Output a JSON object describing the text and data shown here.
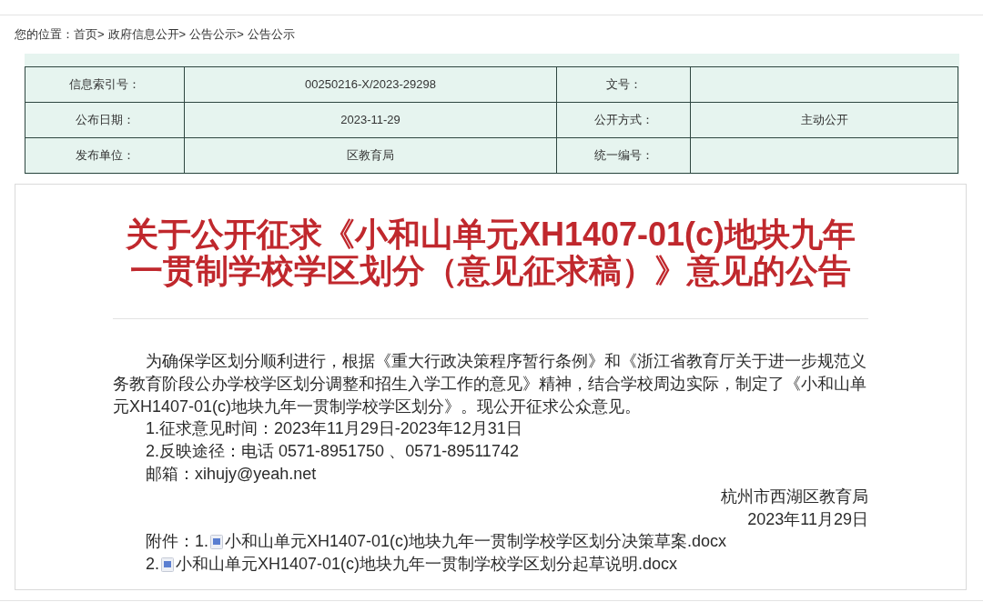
{
  "breadcrumb": {
    "label": "您的位置：",
    "separator": ">",
    "items": [
      "首页",
      "政府信息公开",
      "公告公示",
      "公告公示"
    ]
  },
  "info_table": {
    "rows": [
      {
        "cells": [
          {
            "label": "信息索引号：",
            "value": "00250216-X/2023-29298"
          },
          {
            "label": "文号："
          }
        ]
      },
      {
        "cells": [
          {
            "label": "公布日期：",
            "value": "2023-11-29"
          },
          {
            "label": "公开方式：",
            "value": "主动公开"
          }
        ]
      },
      {
        "cells": [
          {
            "label": "发布单位：",
            "value": "区教育局"
          },
          {
            "label": "统一编号："
          }
        ]
      }
    ]
  },
  "article": {
    "title": "关于公开征求《小和山单元XH1407-01(c)地块九年一贯制学校学区划分（意见征求稿）》意见的公告",
    "body": "为确保学区划分顺利进行，根据《重大行政决策程序暂行条例》和《浙江省教育厅关于进一步规范义务教育阶段公办学校学区划分调整和招生入学工作的意见》精神，结合学校周边实际，制定了《小和山单元XH1407-01(c)地块九年一贯制学校学区划分》。现公开征求公众意见。",
    "items": [
      "1.征求意见时间：2023年11月29日-2023年12月31日",
      "2.反映途径：电话 0571-8951750 、0571-89511742",
      "邮箱：xihujy@yeah.net"
    ],
    "signature": [
      "杭州市西湖区教育局",
      "2023年11月29日"
    ],
    "attachments": {
      "label": "附件：",
      "files": [
        {
          "number": "1.",
          "name": "小和山单元XH1407-01(c)地块九年一贯制学校学区划分决策草案.docx"
        },
        {
          "number": "2.",
          "name": "小和山单元XH1407-01(c)地块九年一贯制学校学区划分起草说明.docx"
        }
      ]
    }
  }
}
